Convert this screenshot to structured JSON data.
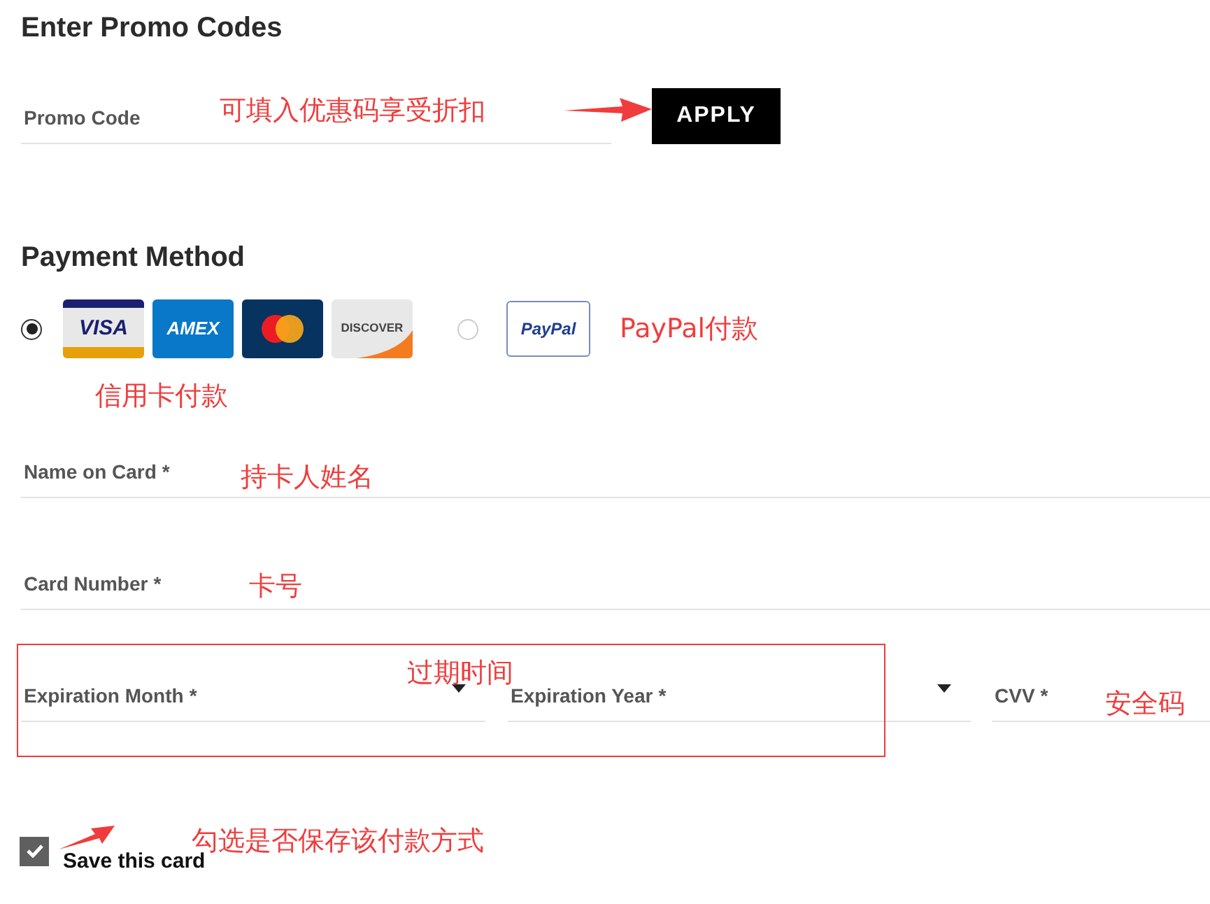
{
  "promo": {
    "heading": "Enter Promo Codes",
    "field_label": "Promo Code",
    "button": "APPLY"
  },
  "payment": {
    "heading": "Payment Method",
    "methods": [
      {
        "kind": "cards",
        "selected": true,
        "cards": [
          {
            "kind": "visa",
            "label": "VISA"
          },
          {
            "kind": "amex",
            "label": "AMEX"
          },
          {
            "kind": "mastercard"
          },
          {
            "kind": "discover",
            "label": "DISCOVER"
          }
        ]
      },
      {
        "kind": "paypal",
        "selected": false,
        "label": "PayPal"
      }
    ]
  },
  "fields": [
    {
      "label": "Name on Card",
      "required": "*"
    },
    {
      "label": "Card Number",
      "required": "*"
    }
  ],
  "expiry_row": [
    {
      "kind": "select",
      "label": "Expiration Month",
      "required": "*"
    },
    {
      "kind": "select",
      "label": "Expiration Year",
      "required": "*"
    },
    {
      "kind": "text",
      "label": "CVV",
      "required": "*"
    }
  ],
  "save_card": {
    "label": "Save this card",
    "checked": true
  },
  "annotations": [
    {
      "text": "可填入优惠码享受折扣"
    },
    {
      "text": "PayPal付款"
    },
    {
      "text": "信用卡付款"
    },
    {
      "text": "持卡人姓名"
    },
    {
      "text": "卡号"
    },
    {
      "text": "过期时间"
    },
    {
      "text": "安全码"
    },
    {
      "text": "勾选是否保存该付款方式"
    }
  ]
}
